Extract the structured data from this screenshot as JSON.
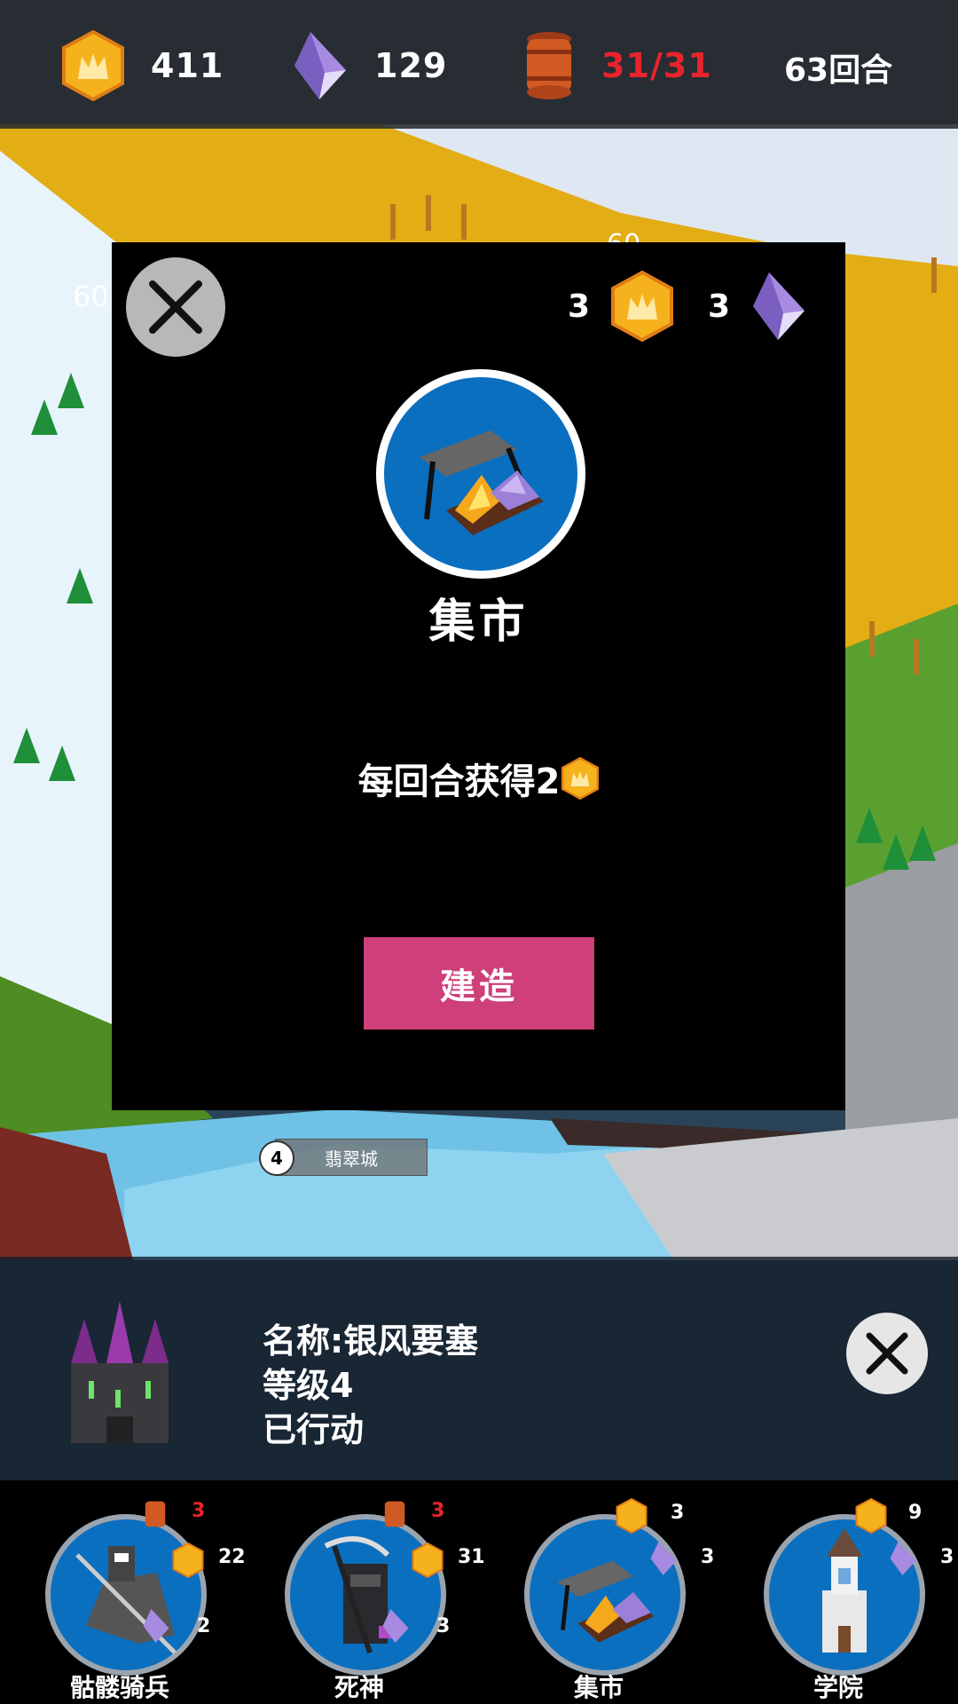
{
  "resources": {
    "stars": "411",
    "crystals": "129",
    "population": "31/31",
    "turns": "63回合"
  },
  "map": {
    "labels": [
      "60",
      "60"
    ],
    "city_level": "4",
    "city_name": "翡翠城"
  },
  "modal": {
    "star_cost": "3",
    "crystal_cost": "3",
    "title": "集市",
    "description": "每回合获得2",
    "build_label": "建造"
  },
  "info": {
    "name_line": "名称:银风要塞",
    "level_line": "等级4",
    "status_line": "已行动"
  },
  "build_options": [
    {
      "name": "骷髅骑兵",
      "pop": "3",
      "stars": "22",
      "crystals": "2"
    },
    {
      "name": "死神",
      "pop": "3",
      "stars": "31",
      "crystals": "3"
    },
    {
      "name": "集市",
      "stars": "3",
      "crystals": "3"
    },
    {
      "name": "学院",
      "stars": "9",
      "crystals": "3"
    }
  ],
  "colors": {
    "accent_build": "#cf3f79",
    "population_red": "#e8242c",
    "icon_blue": "#0b6fc0",
    "star_gold": "#f6b21c",
    "crystal_purple": "#a68be0"
  },
  "icons": [
    "star-icon",
    "crystal-icon",
    "barrel-icon",
    "close-icon",
    "market-icon",
    "castle-icon",
    "skeleton-cavalry-icon",
    "reaper-icon",
    "academy-icon"
  ]
}
